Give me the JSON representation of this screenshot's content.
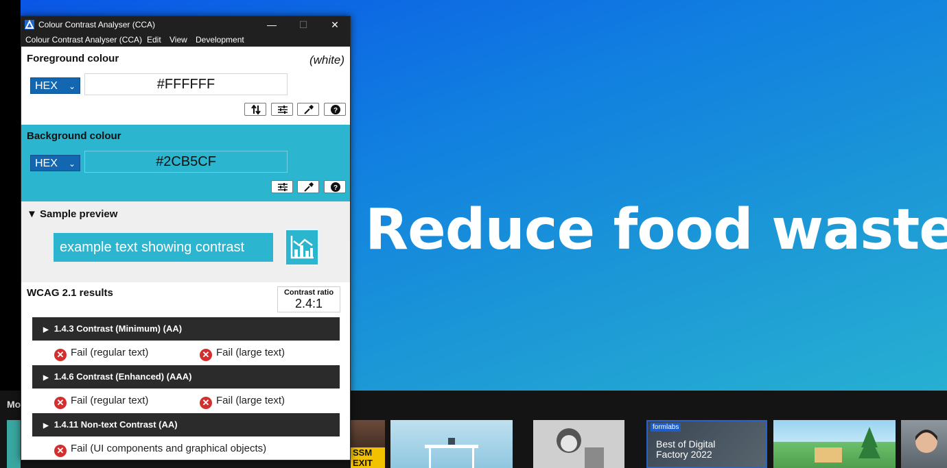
{
  "background_video": {
    "headline": "Reduce food waste",
    "more_label": "Mo",
    "thumbnails": [
      {
        "id": "t1"
      },
      {
        "id": "t2"
      },
      {
        "id": "t3",
        "label": "SSM EXIT"
      },
      {
        "id": "t4"
      },
      {
        "id": "t5"
      },
      {
        "id": "t6",
        "badge": "formlabs",
        "title": "Best of Digital Factory 2022"
      },
      {
        "id": "t7"
      },
      {
        "id": "t8"
      }
    ]
  },
  "window": {
    "title": "Colour Contrast Analyser (CCA)",
    "controls": {
      "minimize": "—",
      "maximize": "☐",
      "close": "✕"
    },
    "menu": [
      "Colour Contrast Analyser (CCA)",
      "Edit",
      "View",
      "Development"
    ]
  },
  "foreground": {
    "title": "Foreground colour",
    "color_name": "(white)",
    "format": "HEX",
    "value": "#FFFFFF",
    "buttons": [
      "swap-icon",
      "sliders-icon",
      "eyedropper-icon",
      "help-icon"
    ]
  },
  "background": {
    "title": "Background colour",
    "format": "HEX",
    "value": "#2CB5CF",
    "buttons": [
      "sliders-icon",
      "eyedropper-icon",
      "help-icon"
    ]
  },
  "preview": {
    "title": "Sample preview",
    "sample_text": "example text showing contrast"
  },
  "results": {
    "title": "WCAG 2.1 results",
    "contrast_label": "Contrast ratio",
    "contrast_value": "2.4:1",
    "criteria": [
      {
        "name": "1.4.3 Contrast (Minimum) (AA)",
        "results": [
          "Fail (regular text)",
          "Fail (large text)"
        ]
      },
      {
        "name": "1.4.6 Contrast (Enhanced) (AAA)",
        "results": [
          "Fail (regular text)",
          "Fail (large text)"
        ]
      },
      {
        "name": "1.4.11 Non-text Contrast (AA)",
        "results": [
          "Fail (UI components and graphical objects)"
        ]
      }
    ]
  },
  "colors": {
    "accent": "#2CB5CF",
    "select_blue": "#1267B0",
    "fail_red": "#D32F2F",
    "title_bar": "#202020"
  }
}
